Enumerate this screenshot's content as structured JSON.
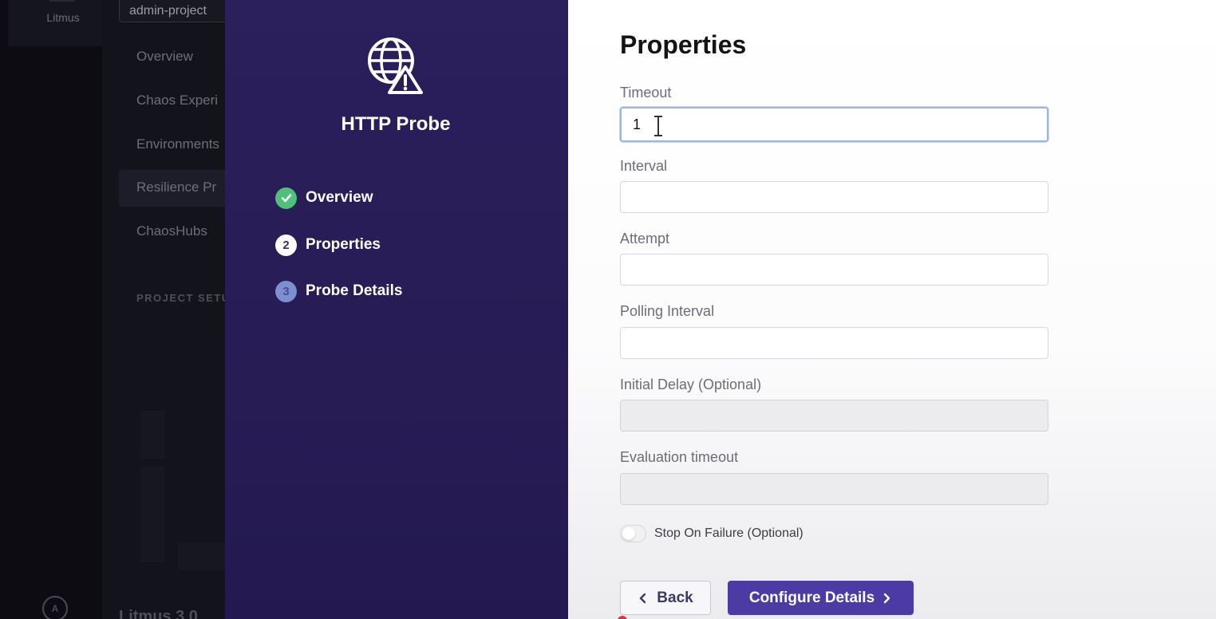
{
  "app": {
    "brand": "Litmus",
    "avatar_initial": "A"
  },
  "nav": {
    "project": "admin-project",
    "items": [
      {
        "label": "Overview"
      },
      {
        "label": "Chaos Experi"
      },
      {
        "label": "Environments"
      },
      {
        "label": "Resilience Pr"
      },
      {
        "label": "ChaosHubs"
      }
    ],
    "section_label": "PROJECT SETU",
    "bottom_label": "Litmus 3.0"
  },
  "drawer": {
    "title": "HTTP Probe",
    "icon": "globe-warning-icon",
    "steps": [
      {
        "label": "Overview",
        "state": "done"
      },
      {
        "label": "Properties",
        "state": "current",
        "number": "2"
      },
      {
        "label": "Probe Details",
        "state": "todo",
        "number": "3"
      }
    ]
  },
  "form": {
    "heading": "Properties",
    "fields": {
      "timeout": {
        "label": "Timeout",
        "value": "1"
      },
      "interval": {
        "label": "Interval",
        "value": ""
      },
      "attempt": {
        "label": "Attempt",
        "value": ""
      },
      "polling_interval": {
        "label": "Polling Interval",
        "value": ""
      },
      "initial_delay": {
        "label": "Initial Delay (Optional)",
        "value": ""
      },
      "evaluation_timeout": {
        "label": "Evaluation timeout",
        "value": ""
      }
    },
    "stop_on_failure": {
      "label": "Stop On Failure (Optional)",
      "checked": false
    },
    "buttons": {
      "back": "Back",
      "next": "Configure Details"
    }
  },
  "colors": {
    "drawer_purple": "#2b1f5c",
    "primary": "#4c3aa5",
    "success": "#4ec079"
  }
}
